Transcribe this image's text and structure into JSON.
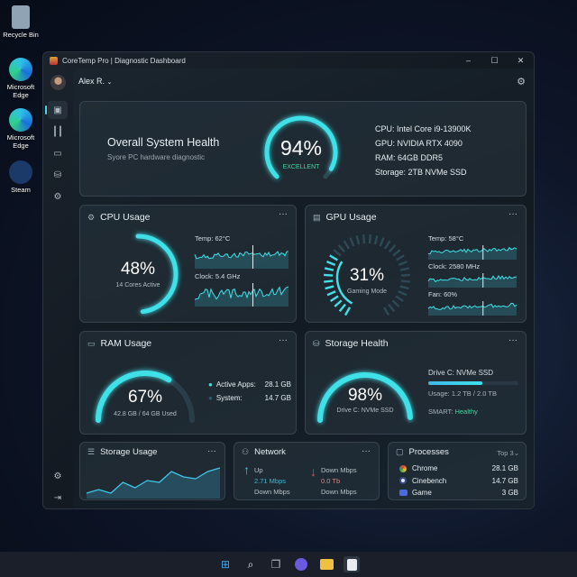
{
  "desktop": {
    "icons": [
      {
        "label": "Recycle Bin"
      },
      {
        "label": "Microsoft Edge"
      },
      {
        "label": "Microsoft Edge"
      },
      {
        "label": "Steam"
      }
    ]
  },
  "window": {
    "title": "CoreTemp Pro | Diagnostic Dashboard"
  },
  "header": {
    "user": "Alex R."
  },
  "health": {
    "title": "Overall System Health",
    "subtitle": "Syore PC hardware diagnostic",
    "percent": "94%",
    "percent_value": 94,
    "status": "EXCELLENT",
    "specs": [
      "CPU: Intel Core i9-13900K",
      "GPU: NVIDIA RTX 4090",
      "RAM: 64GB DDR5",
      "Storage: 2TB NVMe SSD"
    ]
  },
  "cpu": {
    "title": "CPU Usage",
    "percent": "48%",
    "percent_value": 48,
    "sub": "14 Cores Active",
    "temp": "Temp: 62°C",
    "clock": "Clock: 5.4 GHz"
  },
  "gpu": {
    "title": "GPU Usage",
    "percent": "31%",
    "percent_value": 31,
    "sub": "Gaming Mode",
    "temp": "Temp: 58°C",
    "clock": "Clock: 2580 MHz",
    "fan": "Fan: 60%"
  },
  "ram": {
    "title": "RAM Usage",
    "percent": "67%",
    "percent_value": 67,
    "sub": "42.8 GB / 64 GB Used",
    "legend": [
      {
        "label": "Active Apps:",
        "value": "28.1 GB",
        "color": "#3fe0d8"
      },
      {
        "label": "System:",
        "value": "14.7 GB",
        "color": "#2f5a6e"
      }
    ]
  },
  "storage_health": {
    "title": "Storage Health",
    "percent": "98%",
    "percent_value": 98,
    "sub": "Drive C: NVMe SSD",
    "drive": "Drive C: NVMe SSD",
    "usage": "Usage: 1.2 TB / 2.0 TB",
    "usage_fraction": 0.6,
    "smart_label": "SMART:",
    "smart_value": "Healthy"
  },
  "storage_usage": {
    "title": "Storage Usage"
  },
  "network": {
    "title": "Network",
    "up_label": "Up",
    "up_value": "2.71 Mbps",
    "up_sub": "Down Mbps",
    "down_label": "Down Mbps",
    "down_value": "0.0 Tb",
    "down_sub": "Down Mbps"
  },
  "processes": {
    "title": "Processes",
    "filter": "Top 3",
    "items": [
      {
        "name": "Chrome",
        "value": "28.1 GB"
      },
      {
        "name": "Cinebench",
        "value": "14.7 GB"
      },
      {
        "name": "Game",
        "value": "3 GB"
      }
    ]
  },
  "colors": {
    "accent": "#3fe0e8",
    "healthy": "#3fd9a0",
    "down": "#e05050"
  }
}
